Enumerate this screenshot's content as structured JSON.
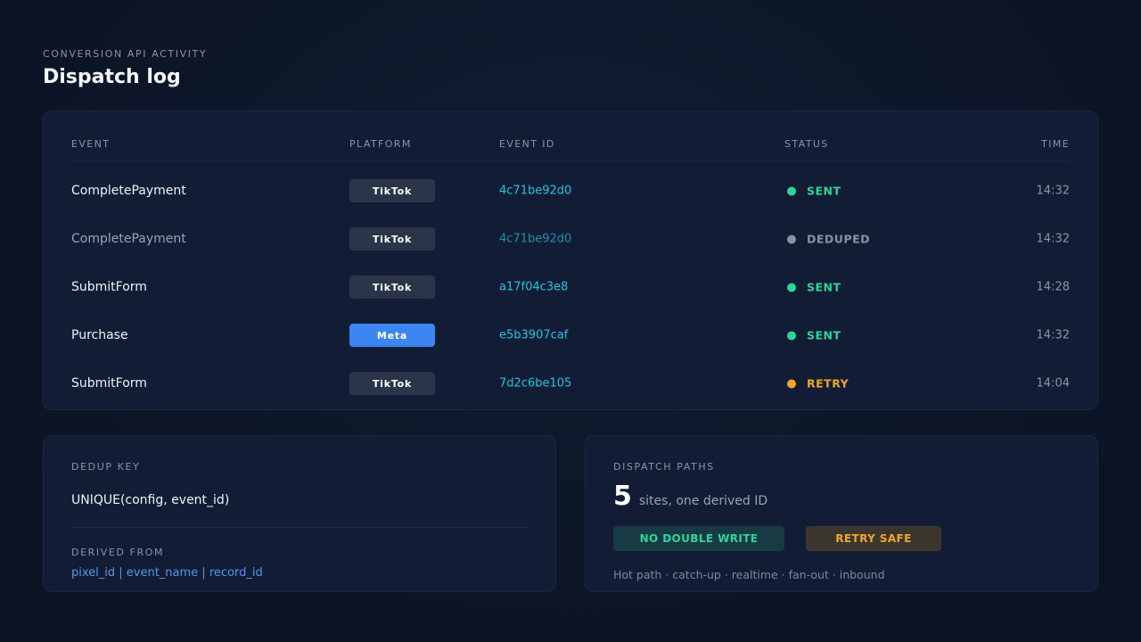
{
  "header": {
    "eyebrow": "CONVERSION API ACTIVITY",
    "title": "Dispatch log"
  },
  "table": {
    "columns": [
      "EVENT",
      "PLATFORM",
      "EVENT ID",
      "STATUS",
      "TIME"
    ],
    "rows": [
      {
        "event": "CompletePayment",
        "platform": "TikTok",
        "event_id": "4c71be92d0",
        "status": "SENT",
        "time": "14:32"
      },
      {
        "event": "CompletePayment",
        "platform": "TikTok",
        "event_id": "4c71be92d0",
        "status": "DEDUPED",
        "time": "14:32"
      },
      {
        "event": "SubmitForm",
        "platform": "TikTok",
        "event_id": "a17f04c3e8",
        "status": "SENT",
        "time": "14:28"
      },
      {
        "event": "Purchase",
        "platform": "Meta",
        "event_id": "e5b3907caf",
        "status": "SENT",
        "time": "14:32"
      },
      {
        "event": "SubmitForm",
        "platform": "TikTok",
        "event_id": "7d2c6be105",
        "status": "RETRY",
        "time": "14:04"
      }
    ]
  },
  "dedup": {
    "label": "DEDUP KEY",
    "value": "UNIQUE(config, event_id)",
    "derived_label": "DERIVED FROM",
    "derived_value": "pixel_id | event_name | record_id"
  },
  "paths": {
    "label": "DISPATCH PATHS",
    "count": "5",
    "count_caption": "sites, one derived ID",
    "tag_primary": "NO DOUBLE WRITE",
    "tag_secondary": "RETRY SAFE",
    "footnote": "Hot path · catch-up · realtime · fan-out · inbound"
  },
  "colors": {
    "sent": "#2fd49a",
    "deduped": "#8a919e",
    "retry": "#f0a52c",
    "tiktok_bg": "#2b3549",
    "tiktok_fg": "#ffffff",
    "meta_bg": "#3b86f0",
    "meta_fg": "#ffffff",
    "accent_id": "#22c4de"
  }
}
